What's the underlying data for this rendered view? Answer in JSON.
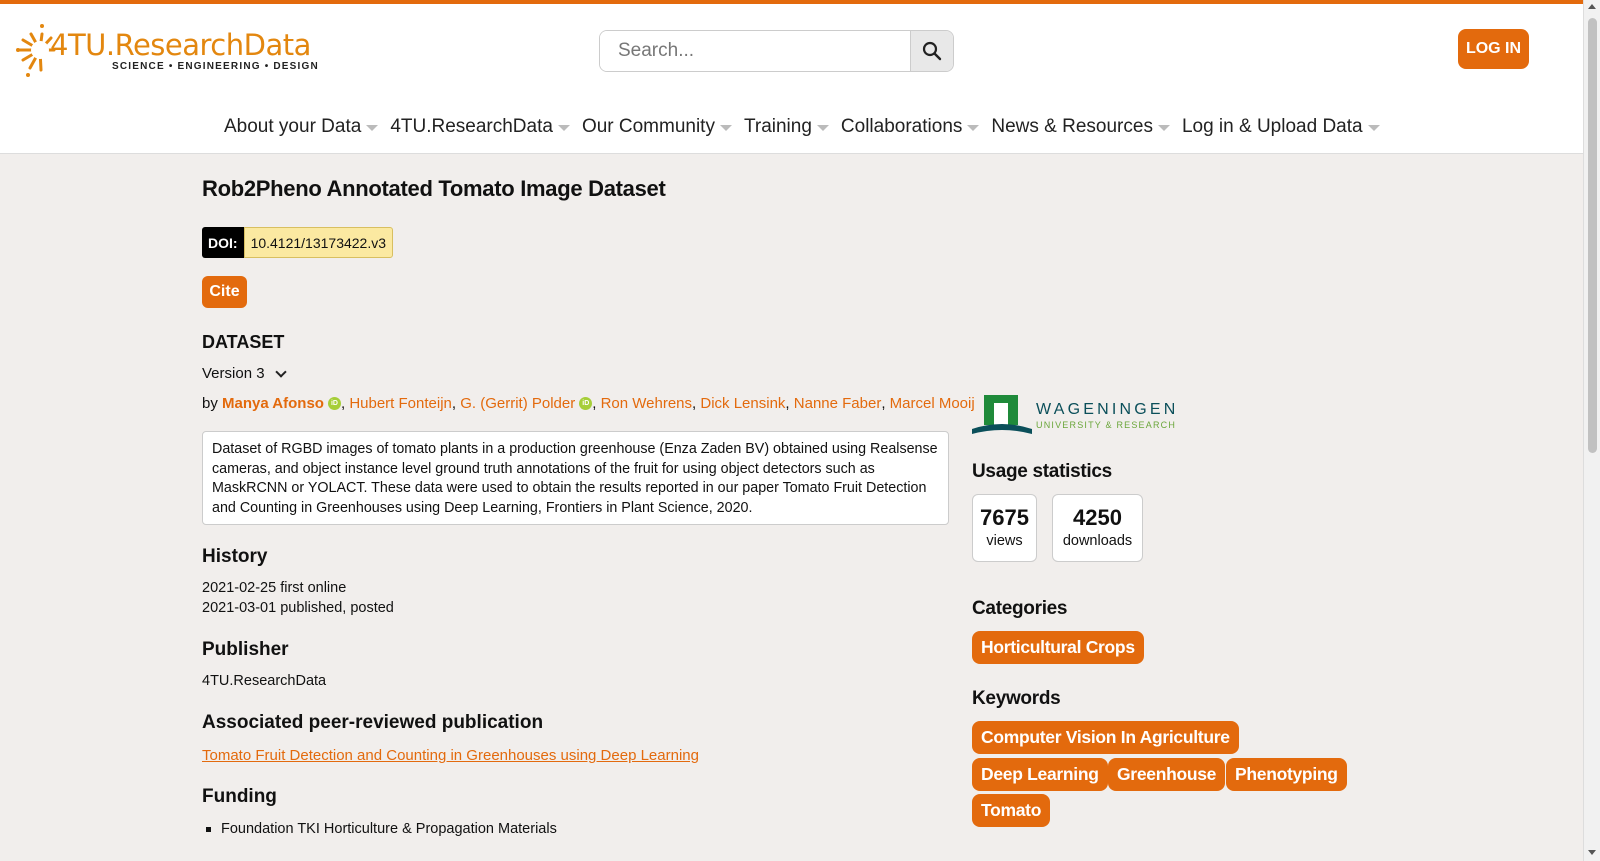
{
  "site": {
    "logo_text_main": "4TU.ResearchData",
    "logo_text_sub": "SCIENCE • ENGINEERING • DESIGN",
    "search_placeholder": "Search...",
    "login_label": "LOG IN",
    "accent_color": "#e36a0d"
  },
  "nav": {
    "items": [
      {
        "label": "About your Data"
      },
      {
        "label": "4TU.ResearchData"
      },
      {
        "label": "Our Community"
      },
      {
        "label": "Training"
      },
      {
        "label": "Collaborations"
      },
      {
        "label": "News & Resources"
      },
      {
        "label": "Log in & Upload Data"
      }
    ]
  },
  "dataset": {
    "title": "Rob2Pheno Annotated Tomato Image Dataset",
    "doi_label": "DOI:",
    "doi_value": "10.4121/13173422.v3",
    "cite_label": "Cite",
    "type_heading": "DATASET",
    "version_label": "Version 3",
    "by_label": "by",
    "authors": [
      {
        "name": "Manya Afonso",
        "orcid": true
      },
      {
        "name": "Hubert Fonteijn",
        "orcid": false
      },
      {
        "name": "G. (Gerrit) Polder",
        "orcid": true
      },
      {
        "name": "Ron Wehrens",
        "orcid": false
      },
      {
        "name": "Dick Lensink",
        "orcid": false
      },
      {
        "name": "Nanne Faber",
        "orcid": false
      },
      {
        "name": "Marcel Mooij",
        "orcid": false
      }
    ],
    "description": "Dataset of RGBD images of tomato plants in a production greenhouse (Enza Zaden BV) obtained using Realsense cameras, and object instance level ground truth annotations of the fruit for using object detectors such as MaskRCNN or YOLACT. These data were used to obtain the results reported in our paper Tomato Fruit Detection and Counting in Greenhouses using Deep Learning, Frontiers in Plant Science, 2020.",
    "history_heading": "History",
    "history": [
      "2021-02-25 first online",
      "2021-03-01 published, posted"
    ],
    "publisher_heading": "Publisher",
    "publisher": "4TU.ResearchData",
    "publication_heading": "Associated peer-reviewed publication",
    "publication_link": "Tomato Fruit Detection and Counting in Greenhouses using Deep Learning",
    "funding_heading": "Funding",
    "funding": [
      "Foundation TKI Horticulture & Propagation Materials"
    ]
  },
  "sidebar": {
    "institution_name": "WAGENINGEN",
    "institution_sub": "UNIVERSITY & RESEARCH",
    "usage_heading": "Usage statistics",
    "views_count": "7675",
    "views_label": "views",
    "downloads_count": "4250",
    "downloads_label": "downloads",
    "categories_heading": "Categories",
    "categories": [
      "Horticultural Crops"
    ],
    "keywords_heading": "Keywords",
    "keywords": [
      "Computer Vision In Agriculture",
      "Deep Learning",
      "Greenhouse",
      "Phenotyping",
      "Tomato"
    ]
  }
}
